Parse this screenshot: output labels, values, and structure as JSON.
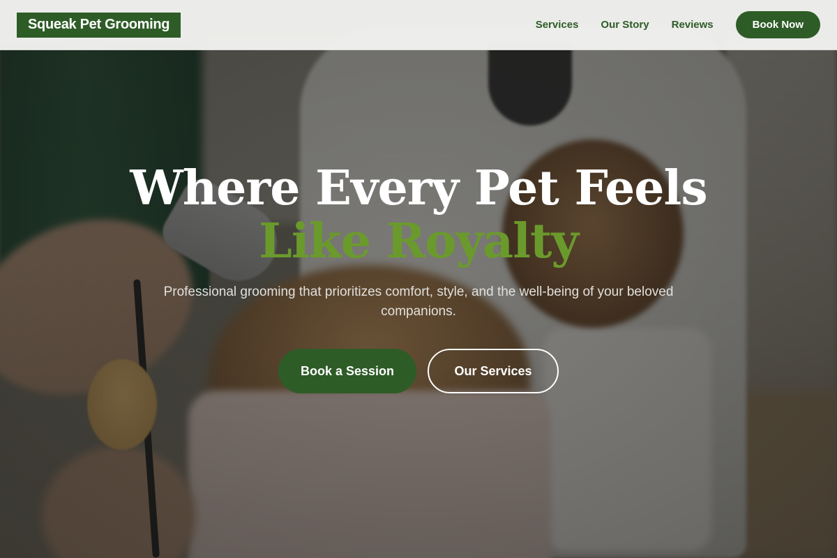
{
  "header": {
    "brand": "Squeak Pet Grooming",
    "nav": [
      {
        "label": "Services"
      },
      {
        "label": "Our Story"
      },
      {
        "label": "Reviews"
      }
    ],
    "cta_label": "Book Now"
  },
  "hero": {
    "headline_line1": "Where Every Pet Feels",
    "headline_line2": "Like Royalty",
    "subtitle": "Professional grooming that prioritizes comfort, style, and the well-being of your beloved companions.",
    "primary_button": "Book a Session",
    "secondary_button": "Our Services"
  },
  "colors": {
    "brand_green": "#2e5c27",
    "accent_green": "#6b9a2c",
    "header_bg": "#f2f2f0",
    "white": "#ffffff"
  }
}
